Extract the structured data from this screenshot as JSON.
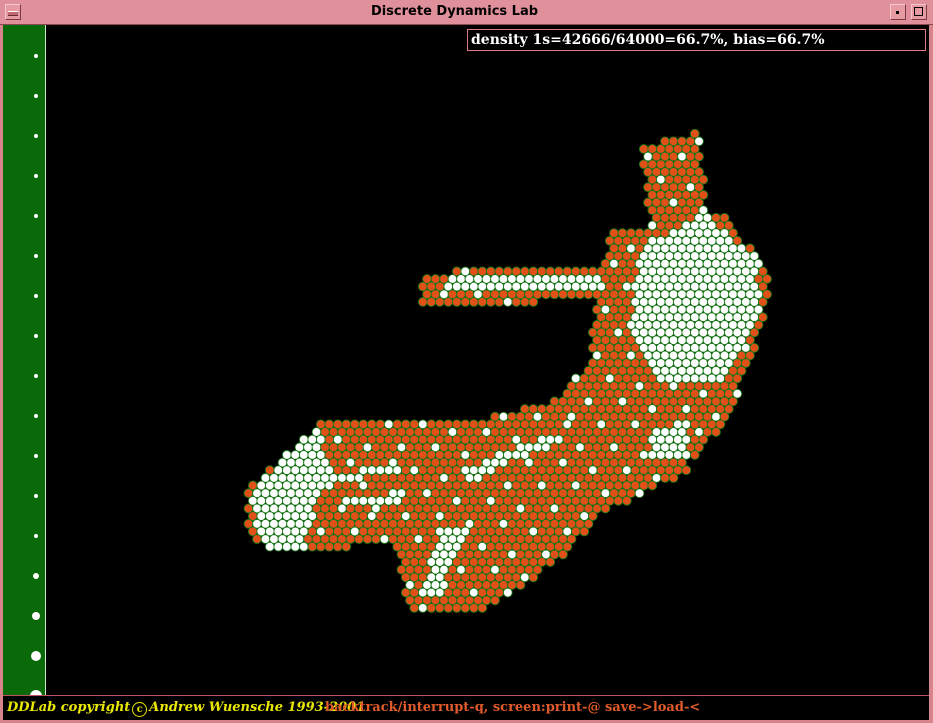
{
  "window": {
    "title": "Discrete Dynamics Lab",
    "menu_icon": "window-menu-icon",
    "minimize_icon": "minimize-icon",
    "maximize_icon": "maximize-icon"
  },
  "readout": {
    "text": "density 1s=42666/64000=66.7%, bias=66.7%"
  },
  "footer": {
    "copyright_pre": "DDLab copyright",
    "copyright_symbol": "c",
    "copyright_post": "Andrew Wuensche 1993-2001",
    "commands": "backtrack/interrupt-q, screen:print-@ save->load-<"
  },
  "colors": {
    "cell_on": "#ffffff",
    "cell_off": "#e05018",
    "cell_outline": "#1a7a1a",
    "side_panel": "#0a6a0a",
    "copyright_text": "#e8e800",
    "command_text": "#e05a2a",
    "title_bar": "#e0909a"
  }
}
